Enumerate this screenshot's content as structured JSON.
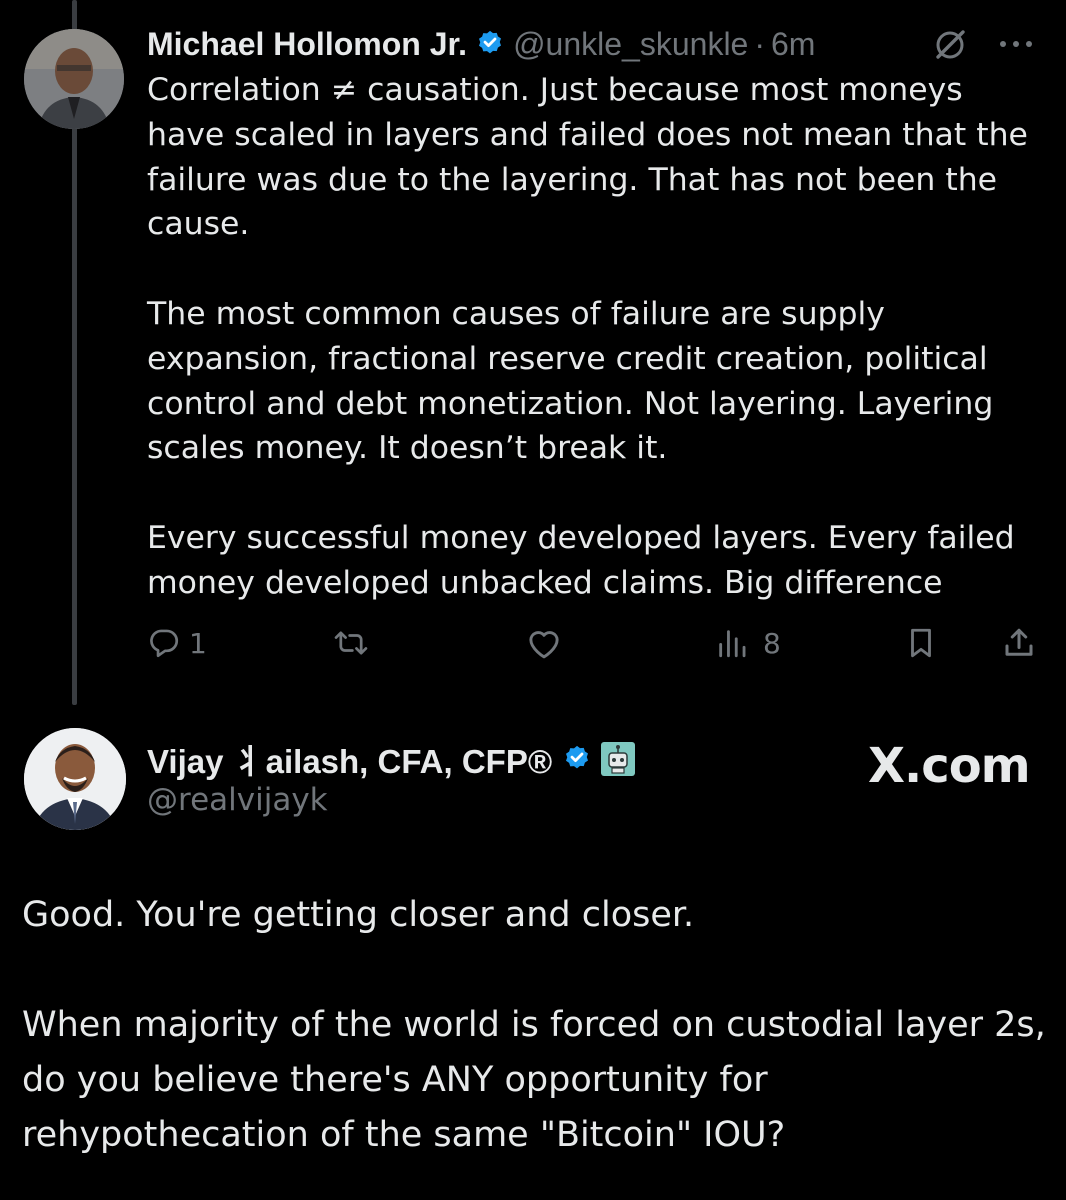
{
  "tweet1": {
    "author_name": "Michael Hollomon Jr.",
    "handle": "@unkle_skunkle",
    "separator": "·",
    "time": "6m",
    "paragraphs": [
      "Correlation ≠ causation. Just because most moneys have scaled in layers and failed does not mean that the failure was due to the layering. That has not been the cause.",
      "The most common causes of failure are supply expansion, fractional reserve credit creation, political control and debt monetization. Not layering. Layering scales money. It doesn’t break it.",
      "Every successful money developed layers. Every failed money developed unbacked claims. Big difference"
    ],
    "actions": {
      "reply_count": "1",
      "retweet_count": "",
      "like_count": "",
      "views_count": "8"
    }
  },
  "tweet2": {
    "author_name": "Vijay ⺦ailash, CFA, CFP®",
    "handle": "@realvijayk",
    "watermark": "X.com",
    "paragraphs": [
      "Good. You're getting closer and closer.",
      "When majority of the world is forced on custodial layer 2s, do you believe there's ANY opportunity for rehypothecation of the same \"Bitcoin\" IOU?"
    ]
  },
  "icons": {
    "verified": "verified-badge-icon",
    "grok": "grok-icon",
    "more": "more-icon",
    "reply": "reply-icon",
    "retweet": "retweet-icon",
    "like": "heart-icon",
    "views": "views-icon",
    "bookmark": "bookmark-icon",
    "share": "share-icon",
    "robot": "robot-emoji-icon"
  },
  "colors": {
    "background": "#000000",
    "text": "#e7e9ea",
    "muted": "#71767b",
    "verified": "#1d9bf0"
  }
}
